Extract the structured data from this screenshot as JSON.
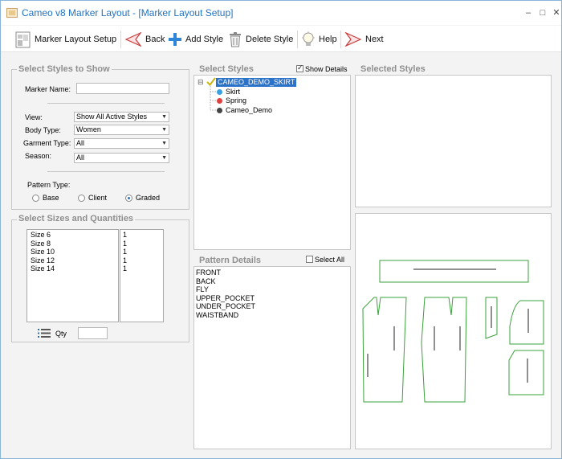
{
  "window": {
    "title": "Cameo v8 Marker Layout - [Marker Layout Setup]",
    "minimize": "–",
    "maximize": "□",
    "close": "✕"
  },
  "toolbar": {
    "setup": "Marker Layout Setup",
    "back": "Back",
    "add_style": "Add Style",
    "delete_style": "Delete Style",
    "help": "Help",
    "next": "Next"
  },
  "styles_filter": {
    "legend": "Select Styles to Show",
    "marker_name_label": "Marker Name:",
    "marker_name_value": "",
    "view_label": "View:",
    "view_value": "Show All Active Styles",
    "body_type_label": "Body Type:",
    "body_type_value": "Women",
    "garment_type_label": "Garment Type:",
    "garment_type_value": "All",
    "season_label": "Season:",
    "season_value": "All",
    "pattern_type_label": "Pattern Type:",
    "pattern_types": [
      "Base",
      "Client",
      "Graded"
    ],
    "pattern_type_selected": "Graded"
  },
  "sizes": {
    "legend": "Select Sizes and Quantities",
    "items": [
      "Size 6",
      "Size 8",
      "Size 10",
      "Size 12",
      "Size 14"
    ],
    "quantities": [
      "1",
      "1",
      "1",
      "1",
      "1"
    ],
    "qty_label": "Qty",
    "qty_value": ""
  },
  "select_styles": {
    "legend": "Select Styles",
    "show_details_label": "Show Details",
    "show_details_checked": true,
    "root": "CAMEO_DEMO_SKIRT",
    "expander": "⊟",
    "children": [
      {
        "label": "Skirt",
        "color": "#3aa0e0"
      },
      {
        "label": "Spring",
        "color": "#e04040"
      },
      {
        "label": "Cameo_Demo",
        "color": "#444444"
      }
    ]
  },
  "pattern_details": {
    "legend": "Pattern Details",
    "select_all_label": "Select All",
    "select_all_checked": false,
    "items": [
      "FRONT",
      "BACK",
      "FLY",
      "UPPER_POCKET",
      "UNDER_POCKET",
      "WAISTBAND"
    ]
  },
  "selected_styles": {
    "legend": "Selected Styles"
  },
  "colors": {
    "accent": "#1f73c4",
    "selection": "#2a73c8",
    "pattern_outline": "#3aa13a",
    "legend_text": "#8f8f8f"
  }
}
